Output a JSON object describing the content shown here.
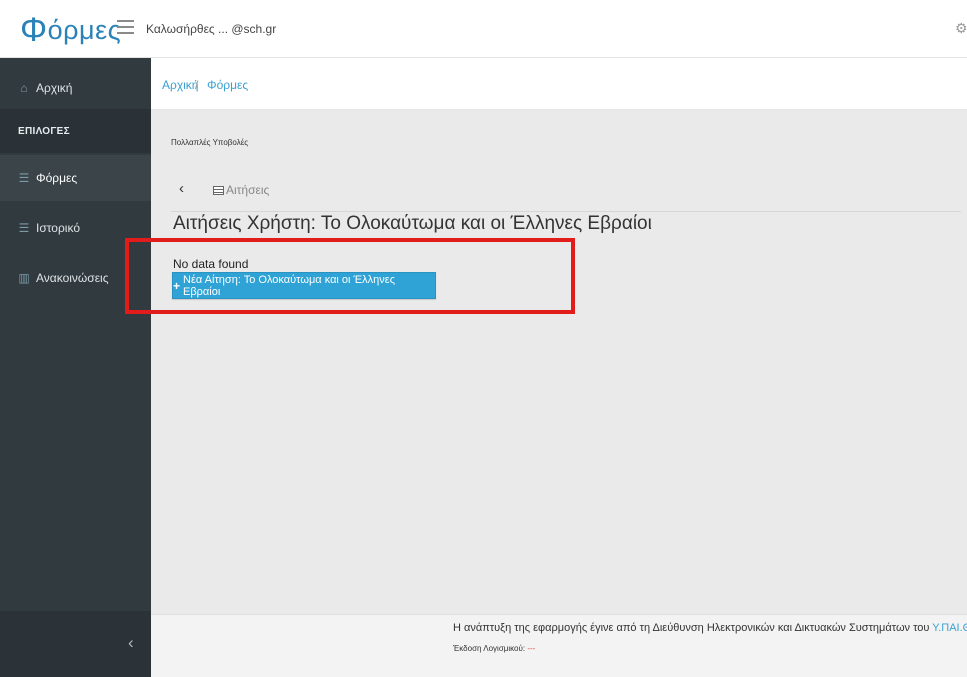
{
  "header": {
    "logo": "Φόρμες",
    "logo_first": "Φ",
    "logo_rest": "όρμες",
    "greeting": "Καλωσήρθες  ...  @sch.gr",
    "settings_icon": "gear-icon"
  },
  "sidebar": {
    "home": {
      "label": "Αρχική",
      "icon": "home-icon"
    },
    "section_label": "ΕΠΙΛΟΓΕΣ",
    "items": [
      {
        "label": "Φόρμες",
        "icon": "list-icon",
        "active": true
      },
      {
        "label": "Ιστορικό",
        "icon": "list-icon",
        "active": false
      },
      {
        "label": "Ανακοινώσεις",
        "icon": "book-icon",
        "active": false
      }
    ],
    "collapse_glyph": "‹"
  },
  "breadcrumb": {
    "home": "Αρχική",
    "separator": "/",
    "current": "Φόρμες"
  },
  "main": {
    "subtitle": "Πολλαπλές Υποβολές",
    "back_glyph": "‹",
    "tab_label": "Αιτήσεις",
    "heading": "Αιτήσεις Χρήστη: Το Ολοκαύτωμα και οι Έλληνες Εβραίοι",
    "empty_message": "No data found",
    "new_button_label": "Νέα Αίτηση: Το Ολοκαύτωμα και οι Έλληνες Εβραίοι",
    "new_button_icon": "plus-icon"
  },
  "footer": {
    "credit_prefix": "Η ανάπτυξη της εφαρμογής έγινε από τη Διεύθυνση Ηλεκτρονικών και Δικτυακών Συστημάτων του ",
    "credit_link": "Υ.ΠΑΙ.Θ.",
    "version_label": "Έκδοση Λογισμικού:",
    "version_value": "---"
  },
  "colors": {
    "accent": "#2fa3d6",
    "sidebar": "#313a3f",
    "highlight": "#e21b1b"
  }
}
